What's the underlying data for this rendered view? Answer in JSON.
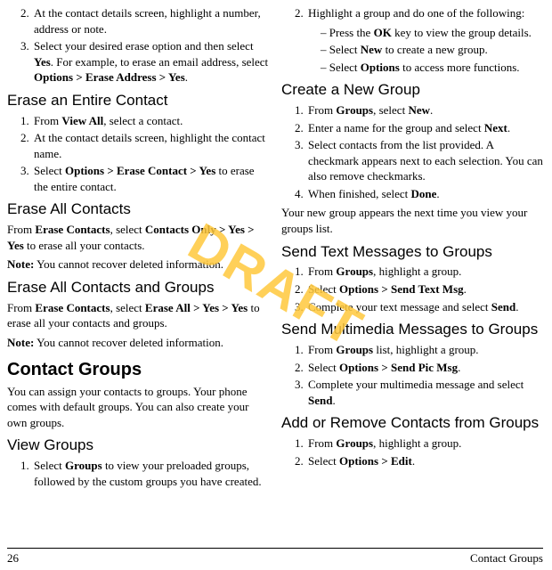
{
  "left": {
    "contactDetails": {
      "step2": "At the contact details screen, highlight a number, address or note.",
      "step3_a": "Select your desired erase option and then select ",
      "step3_yes": "Yes",
      "step3_b": ". For example, to erase an email address, select ",
      "step3_opts": "Options > Erase Address > Yes",
      "step3_c": "."
    },
    "eraseEntire": {
      "title": "Erase an Entire Contact",
      "s1a": "From ",
      "s1b": "View All",
      "s1c": ", select a contact.",
      "s2": "At the contact details screen, highlight the contact name.",
      "s3a": "Select ",
      "s3b": "Options > Erase Contact > Yes",
      "s3c": " to erase the entire contact."
    },
    "eraseAllContacts": {
      "title": "Erase All Contacts",
      "p1a": "From ",
      "p1b": "Erase Contacts",
      "p1c": ", select ",
      "p1d": "Contacts Only > Yes > Yes",
      "p1e": " to erase all your contacts.",
      "noteLabel": "Note:",
      "noteText": " You cannot recover deleted information."
    },
    "eraseAllGroups": {
      "title": "Erase All Contacts and Groups",
      "p1a": "From ",
      "p1b": "Erase Contacts",
      "p1c": ", select ",
      "p1d": "Erase All > Yes > Yes",
      "p1e": " to erase all your contacts and groups.",
      "noteLabel": "Note:",
      "noteText": " You cannot recover deleted information."
    },
    "contactGroups": {
      "title": "Contact Groups",
      "intro": "You can assign your contacts to groups. Your phone comes with default groups. You can also create your own groups."
    },
    "viewGroups": {
      "title": "View Groups",
      "s1a": "Select ",
      "s1b": "Groups",
      "s1c": " to view your preloaded groups, followed by the custom groups you have created."
    }
  },
  "right": {
    "viewGroupsCont": {
      "s2": "Highlight a group and do one of the following:",
      "d1a": "Press the ",
      "d1b": "OK",
      "d1c": " key to view the group details.",
      "d2a": "Select ",
      "d2b": "New",
      "d2c": " to create a new group.",
      "d3a": "Select ",
      "d3b": "Options",
      "d3c": " to access more functions."
    },
    "createGroup": {
      "title": "Create a New Group",
      "s1a": "From ",
      "s1b": "Groups",
      "s1c": ", select ",
      "s1d": "New",
      "s1e": ".",
      "s2a": "Enter a name for the group and select ",
      "s2b": "Next",
      "s2c": ".",
      "s3": "Select contacts from the list provided. A checkmark appears next to each selection. You can also remove checkmarks.",
      "s4a": "When finished, select ",
      "s4b": "Done",
      "s4c": ".",
      "tail": "Your new group appears the next time you view your groups list."
    },
    "sendText": {
      "title": "Send Text Messages to Groups",
      "s1a": "From ",
      "s1b": "Groups",
      "s1c": ", highlight a group.",
      "s2a": "Select ",
      "s2b": "Options > Send Text Msg",
      "s2c": ".",
      "s3a": "Complete your text message and select ",
      "s3b": "Send",
      "s3c": "."
    },
    "sendMM": {
      "title": "Send Multimedia Messages to Groups",
      "s1a": "From ",
      "s1b": "Groups",
      "s1c": " list, highlight a group.",
      "s2a": "Select ",
      "s2b": "Options > Send Pic Msg",
      "s2c": ".",
      "s3a": "Complete your multimedia message and select ",
      "s3b": "Send",
      "s3c": "."
    },
    "addRemove": {
      "title": "Add or Remove Contacts from Groups",
      "s1a": "From ",
      "s1b": "Groups",
      "s1c": ", highlight a group.",
      "s2a": "Select ",
      "s2b": "Options > Edit",
      "s2c": "."
    }
  },
  "footer": {
    "pageNum": "26",
    "section": "Contact Groups"
  },
  "watermark": "DRAFT"
}
